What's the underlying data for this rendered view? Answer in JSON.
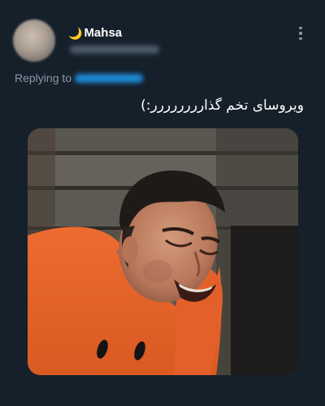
{
  "tweet": {
    "author_name": "Mahsa",
    "name_icon": "crescent-moon-icon",
    "name_icon_glyph": "🌙",
    "replying_prefix": "Replying to",
    "text": "ویروسای تخم گذارررررررر:)",
    "more_icon": "more-vertical-icon",
    "media_description_icon": "photo"
  },
  "colors": {
    "background": "#15202b",
    "secondary_text": "#8b98a5",
    "accent": "#1d9bf0",
    "shirt": "#e8622a"
  }
}
